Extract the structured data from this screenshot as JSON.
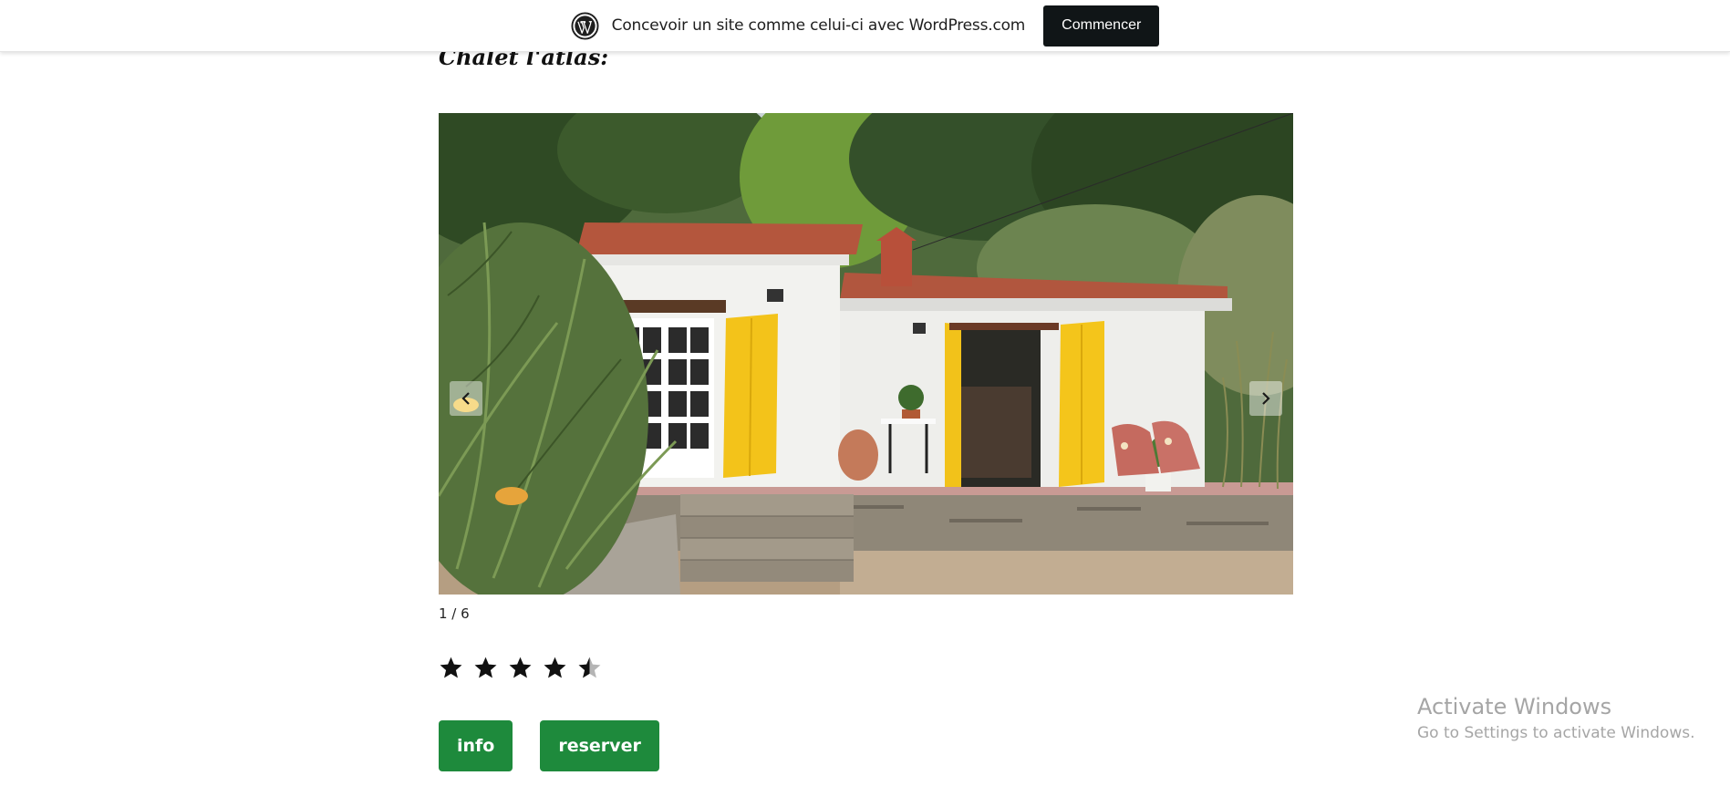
{
  "banner": {
    "text": "Concevoir un site comme celui-ci avec WordPress.com",
    "button_label": "Commencer",
    "logo_icon": "wordpress-logo-icon"
  },
  "post": {
    "heading": "Chalet l'atlas:"
  },
  "slideshow": {
    "counter": "1 / 6",
    "prev_icon": "chevron-left-icon",
    "next_icon": "chevron-right-icon",
    "image_subject": "white chalet with yellow shutters and terracotta roof"
  },
  "rating": {
    "value": 4.5,
    "max": 5,
    "color": "#111111"
  },
  "actions": {
    "info_label": "info",
    "reserver_label": "reserver",
    "button_color": "#1e8a3c"
  },
  "watermark": {
    "title": "Activate Windows",
    "subtitle": "Go to Settings to activate Windows."
  }
}
